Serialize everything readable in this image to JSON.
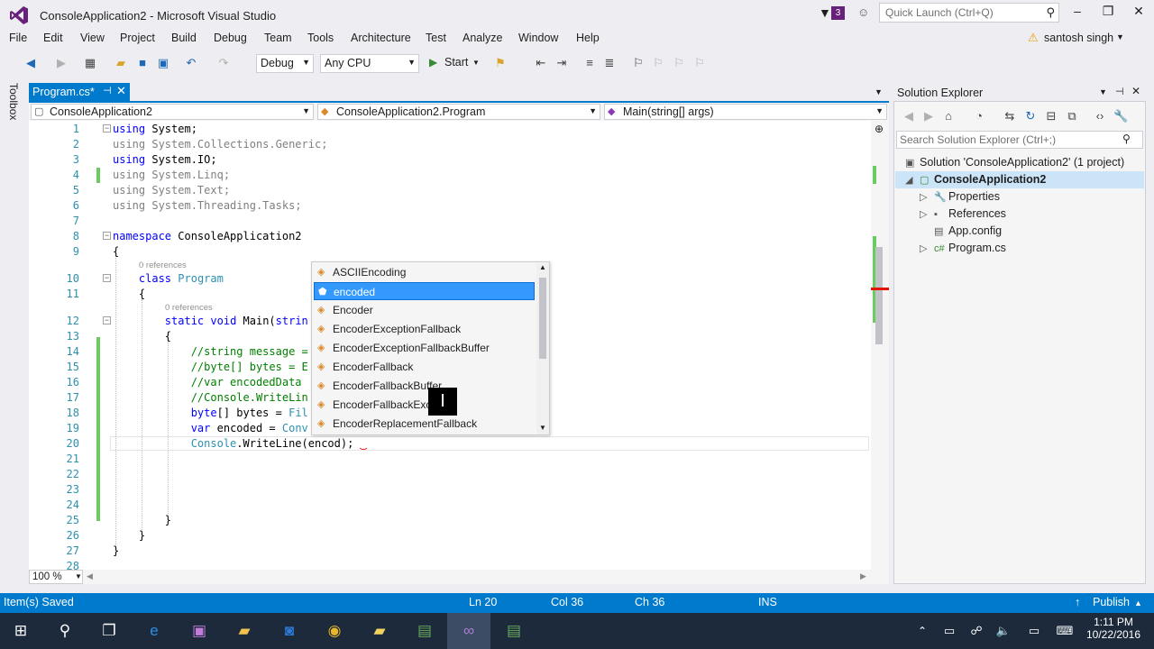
{
  "window": {
    "title": "ConsoleApplication2 - Microsoft Visual Studio",
    "notification_count": "3",
    "quick_launch_placeholder": "Quick Launch (Ctrl+Q)",
    "user": "santosh singh"
  },
  "menu": [
    "File",
    "Edit",
    "View",
    "Project",
    "Build",
    "Debug",
    "Team",
    "Tools",
    "Architecture",
    "Test",
    "Analyze",
    "Window",
    "Help"
  ],
  "toolbar": {
    "config": "Debug",
    "platform": "Any CPU",
    "start_label": "Start"
  },
  "toolbox_label": "Toolbox",
  "doc_tab": {
    "label": "Program.cs*"
  },
  "navbar": {
    "project": "ConsoleApplication2",
    "class": "ConsoleApplication2.Program",
    "member": "Main(string[] args)"
  },
  "editor": {
    "line_numbers": [
      "1",
      "2",
      "3",
      "4",
      "5",
      "6",
      "7",
      "8",
      "9",
      "10",
      "11",
      "12",
      "13",
      "14",
      "15",
      "16",
      "17",
      "18",
      "19",
      "20",
      "21",
      "22",
      "23",
      "24",
      "25",
      "26",
      "27",
      "28"
    ],
    "references_label": "0 references",
    "zoom": "100 %"
  },
  "intellisense": {
    "items": [
      "ASCIIEncoding",
      "encoded",
      "Encoder",
      "EncoderExceptionFallback",
      "EncoderExceptionFallbackBuffer",
      "EncoderFallback",
      "EncoderFallbackBuffer",
      "EncoderFallbackExce",
      "EncoderReplacementFallback"
    ],
    "selected": "encoded"
  },
  "solution_explorer": {
    "title": "Solution Explorer",
    "search_placeholder": "Search Solution Explorer (Ctrl+;)",
    "solution": "Solution 'ConsoleApplication2' (1 project)",
    "project": "ConsoleApplication2",
    "items": [
      "Properties",
      "References",
      "App.config",
      "Program.cs"
    ]
  },
  "status": {
    "message": "Item(s) Saved",
    "line": "Ln 20",
    "col": "Col 36",
    "ch": "Ch 36",
    "mode": "INS",
    "publish": "Publish"
  },
  "taskbar": {
    "time": "1:11 PM",
    "date": "10/22/2016"
  },
  "colors": {
    "accent": "#007acc",
    "selection": "#3399ff",
    "keyword": "#0000ff",
    "type": "#2b91af",
    "comment": "#008000"
  }
}
